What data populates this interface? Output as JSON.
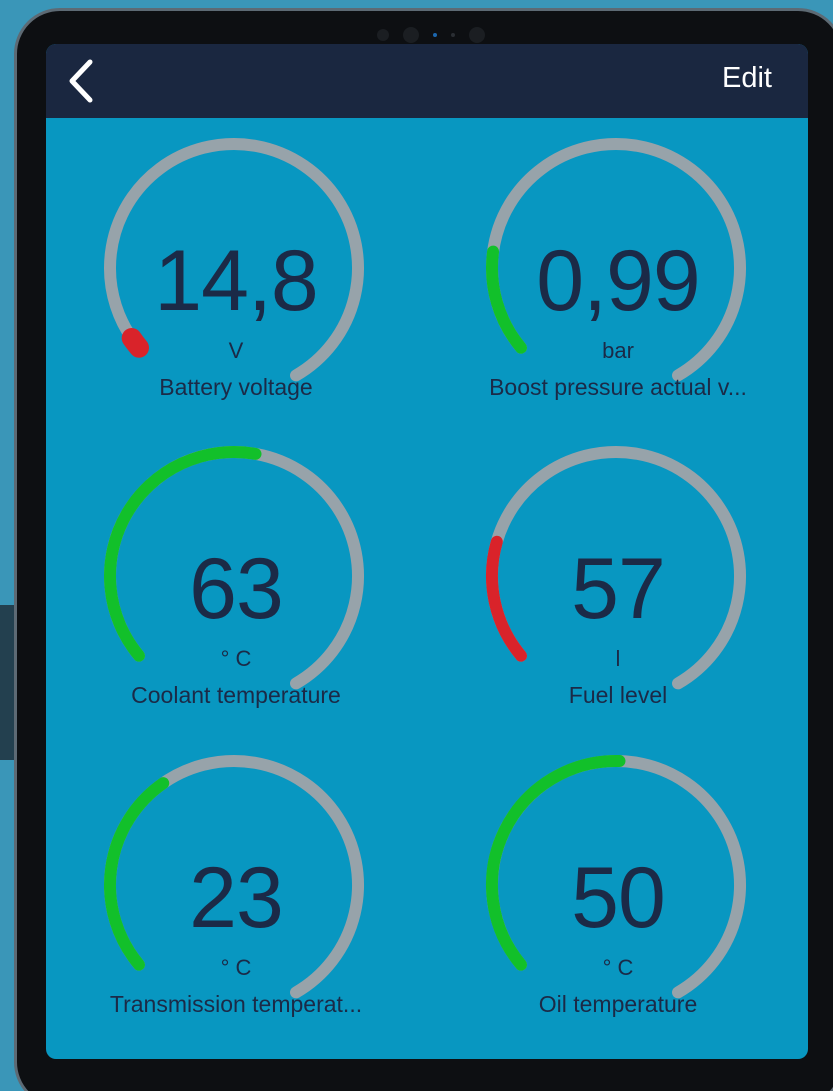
{
  "nav": {
    "back_icon": "chevron-left-icon",
    "edit_label": "Edit"
  },
  "colors": {
    "screen_bg": "#0897c1",
    "nav_bg": "#1a2740",
    "track": "#97a3aa",
    "ok": "#12c02a",
    "warn": "#d9232a",
    "text": "#1b2a47"
  },
  "gauges": [
    {
      "value": "14,8",
      "unit": "V",
      "label": "Battery voltage",
      "fill_fraction": 0.02,
      "status": "warn"
    },
    {
      "value": "0,99",
      "unit": "bar",
      "label": "Boost pressure actual v...",
      "fill_fraction": 0.17,
      "status": "ok"
    },
    {
      "value": "63",
      "unit": "° C",
      "label": "Coolant temperature",
      "fill_fraction": 0.5,
      "status": "ok"
    },
    {
      "value": "57",
      "unit": "l",
      "label": "Fuel level",
      "fill_fraction": 0.2,
      "status": "warn"
    },
    {
      "value": "23",
      "unit": "° C",
      "label": "Transmission temperat...",
      "fill_fraction": 0.34,
      "status": "ok"
    },
    {
      "value": "50",
      "unit": "° C",
      "label": "Oil temperature",
      "fill_fraction": 0.47,
      "status": "ok"
    }
  ]
}
